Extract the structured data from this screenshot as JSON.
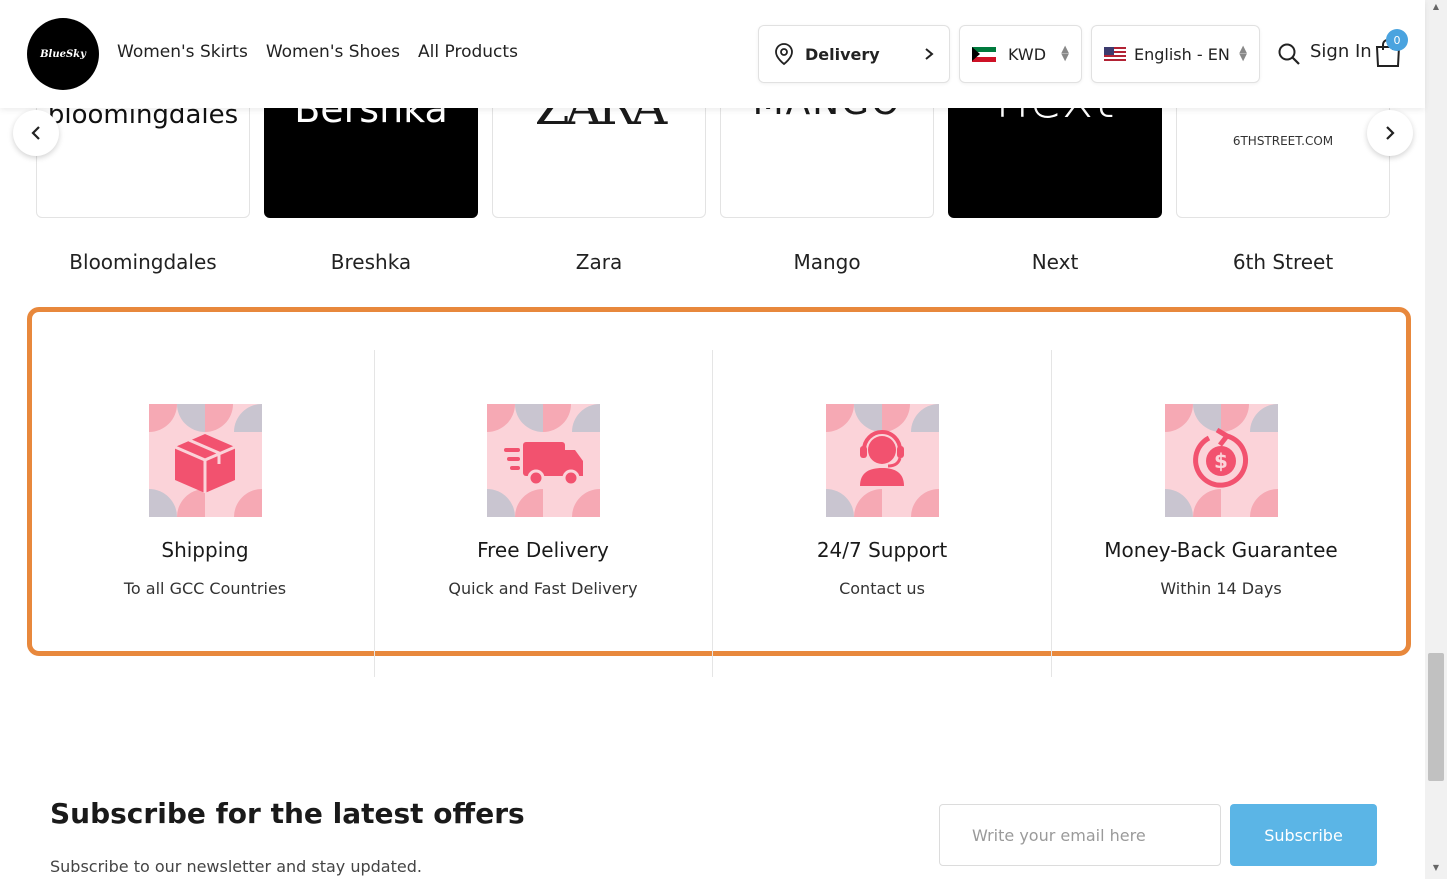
{
  "header": {
    "logo_text": "BlueSky",
    "nav": [
      "Women's Skirts",
      "Women's Shoes",
      "All Products"
    ],
    "delivery_label": "Delivery",
    "currency": "KWD",
    "language": "English - EN",
    "signin_label": "Sign In",
    "cart_count": "0"
  },
  "brands": [
    {
      "name": "Bloomingdales",
      "logo": "bloomingdales",
      "dark": false
    },
    {
      "name": "Breshka",
      "logo": "Bershka",
      "dark": true
    },
    {
      "name": "Zara",
      "logo": "ZARA",
      "dark": false
    },
    {
      "name": "Mango",
      "logo": "MANGO",
      "dark": false
    },
    {
      "name": "Next",
      "logo": "next",
      "dark": true
    },
    {
      "name": "6th Street",
      "logo": "6THSTREET.COM",
      "dark": false
    }
  ],
  "features": [
    {
      "title": "Shipping",
      "subtitle": "To all GCC Countries",
      "icon": "box-icon"
    },
    {
      "title": "Free Delivery",
      "subtitle": "Quick and Fast Delivery",
      "icon": "truck-icon"
    },
    {
      "title": "24/7 Support",
      "subtitle": "Contact us",
      "icon": "headset-icon"
    },
    {
      "title": "Money-Back Guarantee",
      "subtitle": "Within 14 Days",
      "icon": "money-back-icon"
    }
  ],
  "subscribe": {
    "title": "Subscribe for the latest offers",
    "text": "Subscribe to our newsletter and stay updated.",
    "placeholder": "Write your email here",
    "button": "Subscribe"
  },
  "colors": {
    "highlight": "#e8883c",
    "accent": "#5bb5e6",
    "icon_pink": "#f2526f",
    "icon_bg": "#fbd3d9"
  }
}
